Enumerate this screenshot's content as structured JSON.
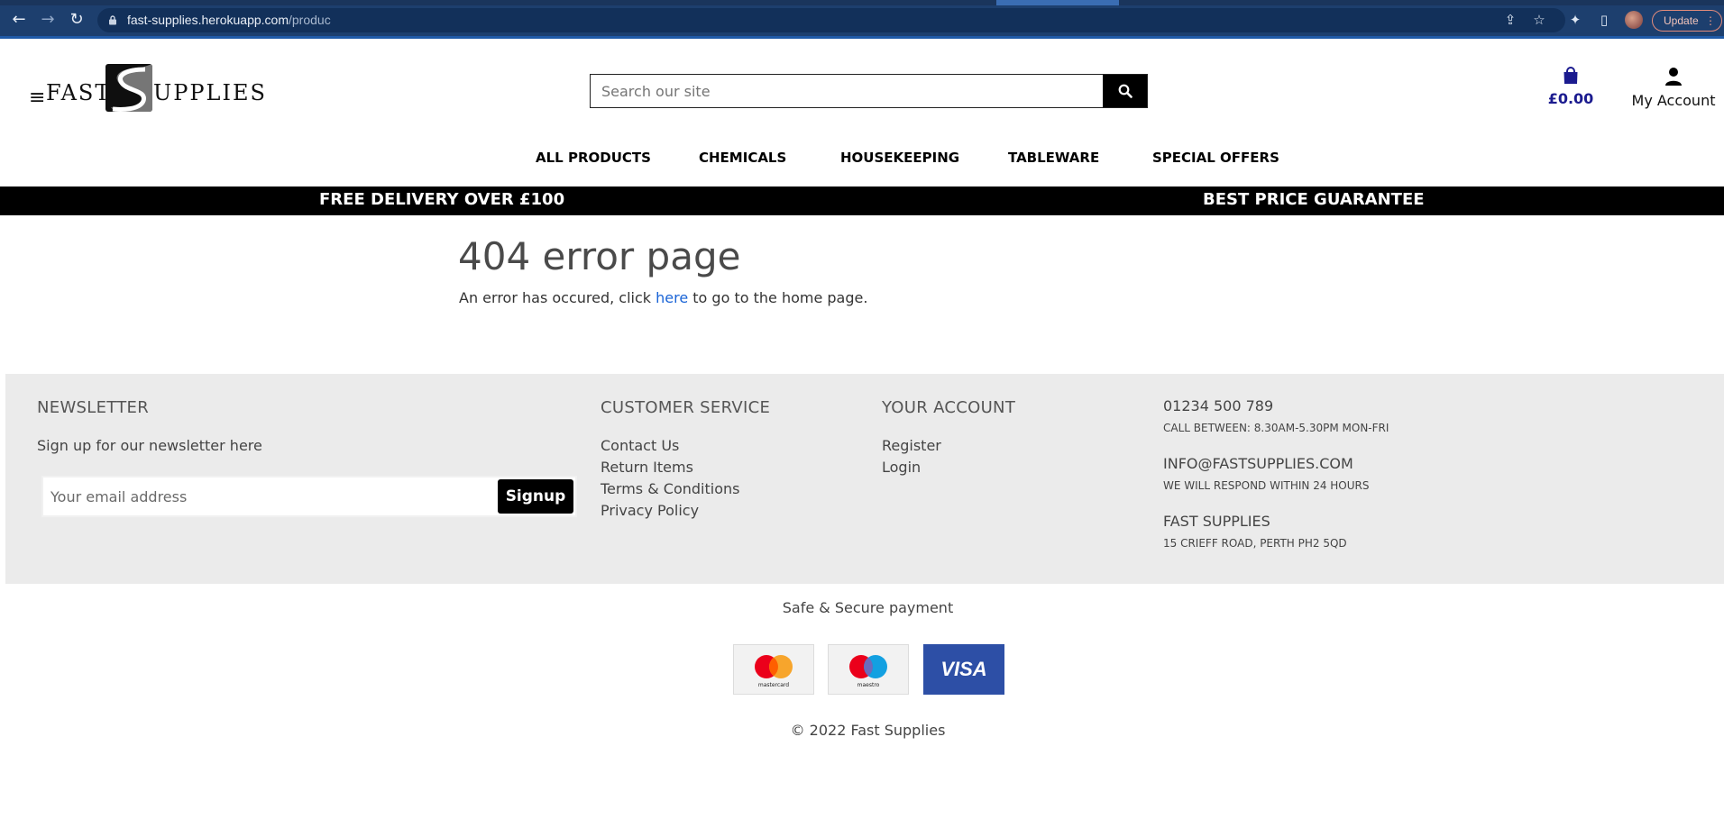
{
  "browser": {
    "url_host": "fast-supplies.herokuapp.com",
    "url_path": "/produc",
    "update_label": "Update",
    "icons": [
      "back-icon",
      "forward-icon",
      "reload-icon",
      "lock-icon",
      "share-icon",
      "star-icon",
      "extensions-icon",
      "side-panel-icon",
      "profile-avatar",
      "menu-dots-icon"
    ]
  },
  "header": {
    "logo_left": "FAST",
    "logo_right": "UPPLIES",
    "search_placeholder": "Search our site",
    "bag_total": "£0.00",
    "account_label": "My Account",
    "bag_color": "#1b1b8f"
  },
  "nav": {
    "items": [
      "ALL PRODUCTS",
      "CHEMICALS",
      "HOUSEKEEPING",
      "TABLEWARE",
      "SPECIAL OFFERS"
    ]
  },
  "promo": {
    "left": "FREE DELIVERY OVER £100",
    "right": "BEST PRICE GUARANTEE"
  },
  "main": {
    "title": "404 error page",
    "text_before": "An error has occured, click ",
    "link": "here",
    "text_after": " to go to the home page.",
    "link_color": "#1a64d6"
  },
  "footer": {
    "newsletter": {
      "heading": "NEWSLETTER",
      "text": "Sign up for our newsletter here",
      "placeholder": "Your email address",
      "button": "Signup"
    },
    "customer_service": {
      "heading": "CUSTOMER SERVICE",
      "links": [
        "Contact Us",
        "Return Items",
        "Terms & Conditions",
        "Privacy Policy"
      ]
    },
    "your_account": {
      "heading": "YOUR ACCOUNT",
      "links": [
        "Register",
        "Login"
      ]
    },
    "contact": {
      "phone": "01234 500 789",
      "hours": "CALL BETWEEN: 8.30AM-5.30PM MON-FRI",
      "email": "INFO@FASTSUPPLIES.COM",
      "response": "WE WILL RESPOND WITHIN 24 HOURS",
      "company": "FAST SUPPLIES",
      "address": "15 CRIEFF ROAD, PERTH PH2 5QD"
    }
  },
  "payments": {
    "heading": "Safe & Secure payment",
    "cards": [
      {
        "name": "mastercard"
      },
      {
        "name": "maestro"
      },
      {
        "name": "VISA"
      }
    ]
  },
  "copyright": "© 2022 Fast Supplies"
}
